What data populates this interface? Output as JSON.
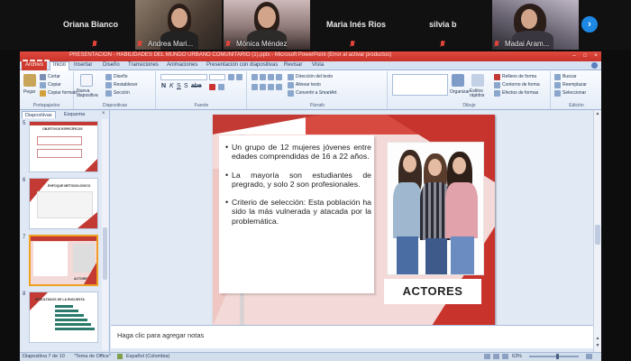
{
  "call": {
    "participants": [
      {
        "name": "Oriana Bianco",
        "muted": true
      },
      {
        "name": "Andrea Mari...",
        "muted": true,
        "video": true
      },
      {
        "name": "Mónica Méndez",
        "muted": true,
        "video": true
      },
      {
        "name": "Maria Inés Rios",
        "muted": true
      },
      {
        "name": "silvia b",
        "muted": true
      },
      {
        "name": "Madai Aram...",
        "muted": true,
        "video": true
      }
    ],
    "next_icon": "chevron-right-icon"
  },
  "ppt": {
    "title": "PRESENTACIÓN - HABILIDADES DEL MUNDO URBANO COMUNITARIO (1).pptx - Microsoft PowerPoint (Error al activar productos)",
    "tabs": [
      "Archivo",
      "Inicio",
      "Insertar",
      "Diseño",
      "Transiciones",
      "Animaciones",
      "Presentación con diapositivas",
      "Revisar",
      "Vista"
    ],
    "active_tab": "Inicio",
    "ribbon": {
      "portapapeles": {
        "label": "Portapapeles",
        "pegar": "Pegar",
        "cortar": "Cortar",
        "copiar": "Copiar",
        "copiar_formato": "Copiar formato"
      },
      "diapositivas": {
        "label": "Diapositivas",
        "nueva": "Nueva diapositiva",
        "diseno": "Diseño",
        "restablecer": "Restablecer",
        "seccion": "Sección"
      },
      "fuente": {
        "label": "Fuente"
      },
      "parrafo": {
        "label": "Párrafo",
        "direccion": "Dirección del texto",
        "alinear": "Alinear texto",
        "smartart": "Convertir a SmartArt"
      },
      "dibujo": {
        "label": "Dibujo",
        "organizar": "Organizar",
        "estilos": "Estilos rápidos",
        "relleno": "Relleno de forma",
        "contorno": "Contorno de forma",
        "efectos": "Efectos de formas"
      },
      "edicion": {
        "label": "Edición",
        "buscar": "Buscar",
        "reemplazar": "Reemplazar",
        "seleccionar": "Seleccionar"
      }
    },
    "pane_tabs": [
      "Diapositivas",
      "Esquema"
    ],
    "thumbnails": [
      {
        "num": "5",
        "title": "OBJETIVOS ESPECÍFICOS"
      },
      {
        "num": "6",
        "title": "ENFOQUE METODOLÓGICO"
      },
      {
        "num": "7",
        "title": "ACTORES"
      },
      {
        "num": "8",
        "title": "RESULTADOS DE LA ENCUESTA"
      }
    ],
    "slide": {
      "bullets": [
        "Un grupo de 12 mujeres jóvenes entre edades comprendidas de 16 a 22 años.",
        "La mayoría son estudiantes de pregrado, y solo 2 son profesionales.",
        "Criterio de selección: Esta población ha sido la más vulnerada y atacada por la problemática."
      ],
      "heading": "ACTORES"
    },
    "notes_placeholder": "Haga clic para agregar notas",
    "status": {
      "slide_info": "Diapositiva 7 de 10",
      "theme": "\"Tema de Office\"",
      "language": "Español (Colombia)",
      "zoom": "63%"
    }
  }
}
